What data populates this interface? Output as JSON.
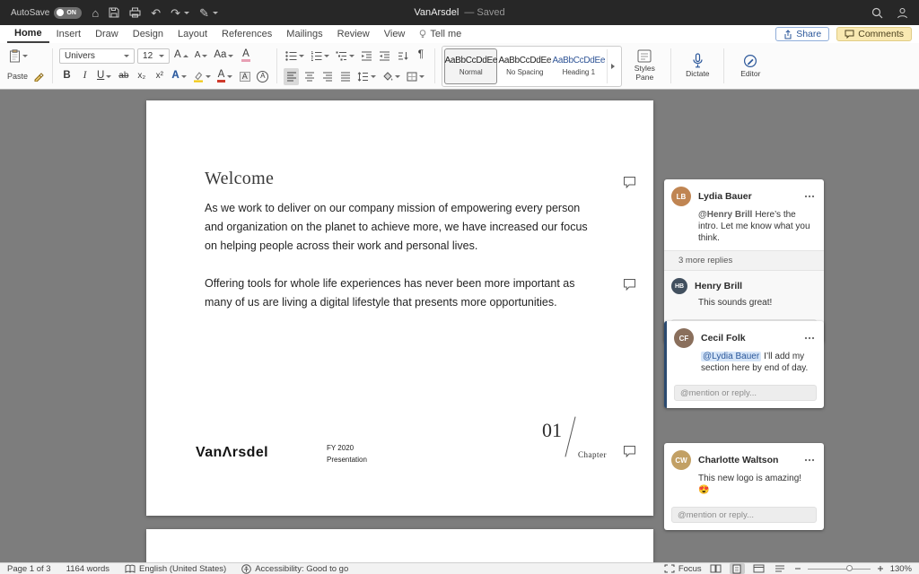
{
  "titlebar": {
    "autosave_label": "AutoSave",
    "autosave_state": "ON",
    "doc_title": "VanArsdel",
    "save_status": "— Saved"
  },
  "icons": {
    "home": "⌂",
    "undo": "↶",
    "redo": "↷",
    "format_pen": "✎",
    "pilcrow": "¶"
  },
  "tabs": {
    "items": [
      "Home",
      "Insert",
      "Draw",
      "Design",
      "Layout",
      "References",
      "Mailings",
      "Review",
      "View",
      "Tell me"
    ],
    "share_label": "Share",
    "comments_label": "Comments"
  },
  "ribbon": {
    "paste_label": "Paste",
    "font_name": "Univers",
    "font_size": "12",
    "glyphs": {
      "grow_font": "A",
      "shrink_font": "A",
      "change_case": "Aa",
      "clear_format": "A",
      "bold": "B",
      "italic": "I",
      "underline": "U",
      "strike": "ab",
      "subscript": "x₂",
      "superscript": "x²",
      "text_effects": "A",
      "font_color": "A",
      "char_shading": "A",
      "enclose": "A"
    },
    "styles": [
      {
        "preview": "AaBbCcDdEe",
        "name": "Normal"
      },
      {
        "preview": "AaBbCcDdEe",
        "name": "No Spacing"
      },
      {
        "preview": "AaBbCcDdEe",
        "name": "Heading 1"
      }
    ],
    "styles_pane_label": "Styles Pane",
    "dictate_label": "Dictate",
    "editor_label": "Editor"
  },
  "document": {
    "heading": "Welcome",
    "paragraph1": "As we work to deliver on our company mission of empowering every person and organization on the planet to achieve more, we have increased our focus on helping people across their work and personal lives.",
    "paragraph2": "Offering tools for whole life experiences has never been more important as many of us are living a digital lifestyle that presents more opportunities.",
    "footer": {
      "logo": "VanΛrsdel",
      "fiscal_year": "FY 2020",
      "subtitle": "Presentation",
      "chapter_number": "01",
      "chapter_label": "Chapter"
    }
  },
  "comments": {
    "avatars": {
      "lydia": "LB",
      "henry": "HB",
      "cecil": "CF",
      "charlotte": "CW"
    },
    "thread1": {
      "author": "Lydia Bauer",
      "mention": "@Henry Brill",
      "text": "Here’s the intro. Let me know what you think.",
      "more_replies": "3 more replies",
      "reply": {
        "author": "Henry Brill",
        "text": "This sounds great!"
      },
      "reply_placeholder": "@mention or reply..."
    },
    "thread2": {
      "author": "Cecil Folk",
      "mention": "@Lydia Bauer",
      "text": "I’ll add my section here by end of day.",
      "reply_placeholder": "@mention or reply..."
    },
    "thread3": {
      "author": "Charlotte Waltson",
      "text": "This new logo is amazing! 😍",
      "reply_placeholder": "@mention or reply..."
    }
  },
  "statusbar": {
    "page": "Page 1 of 3",
    "words": "1164 words",
    "language": "English (United States)",
    "accessibility": "Accessibility: Good to go",
    "focus_label": "Focus",
    "zoom_level": "130%"
  },
  "colors": {
    "accent_blue": "#2b579a",
    "mention_highlight": "#d5e5f8",
    "comments_button": "#f9e9b2"
  }
}
